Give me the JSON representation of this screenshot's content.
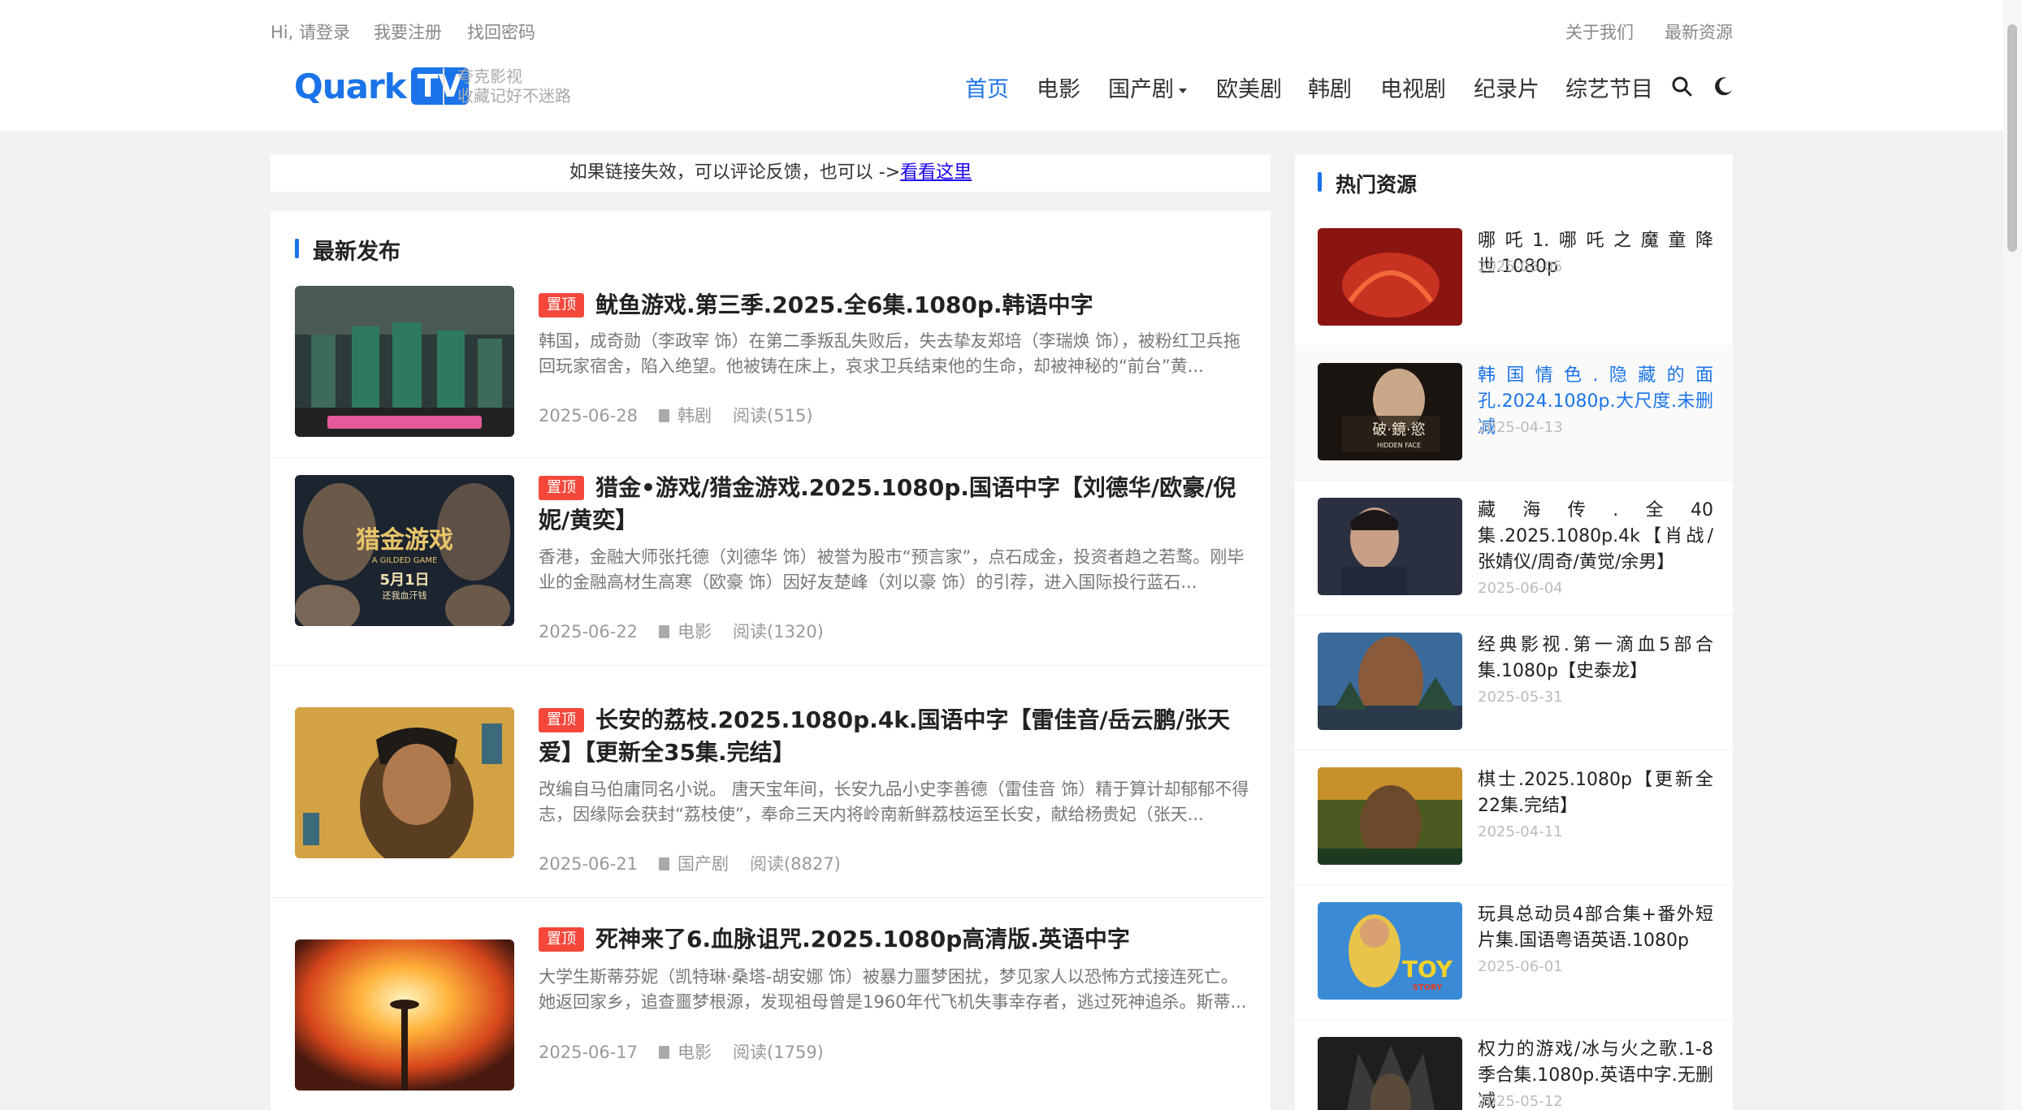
{
  "topbar": {
    "login": "Hi, 请登录",
    "register": "我要注册",
    "recover": "找回密码",
    "about": "关于我们",
    "latest": "最新资源"
  },
  "logo": {
    "quark": "Quark",
    "tv": "TV",
    "slogan_line1": "夸克影视",
    "slogan_line2": "收藏记好不迷路"
  },
  "nav": [
    "首页",
    "电影",
    "国产剧",
    "欧美剧",
    "韩剧",
    "电视剧",
    "纪录片",
    "综艺节目"
  ],
  "icons": {
    "search": "search-icon",
    "theme": "moon-icon"
  },
  "colors": {
    "accent": "#1a73e8",
    "badge": "#f5483b"
  },
  "notice": {
    "text": "如果链接失效，可以评论反馈，也可以 ->",
    "link": "看看这里"
  },
  "main": {
    "title": "最新发布",
    "badge": "置顶",
    "posts": [
      {
        "title": "鱿鱼游戏.第三季.2025.全6集.1080p.韩语中字",
        "excerpt": "韩国，成奇勋（李政宰 饰）在第二季叛乱失败后，失去挚友郑培（李瑞焕 饰），被粉红卫兵拖回玩家宿舍，陷入绝望。他被铸在床上，哀求卫兵结束他的生命，却被神秘的“前台”黄...",
        "date": "2025-06-28",
        "category": "韩剧",
        "views": "阅读(515)"
      },
      {
        "title": "猎金•游戏/猎金游戏.2025.1080p.国语中字【刘德华/欧豪/倪妮/黄奕】",
        "excerpt": "香港，金融大师张托德（刘德华 饰）被誉为股市“预言家”，点石成金，投资者趋之若鹜。刚毕业的金融高材生高寒（欧豪 饰）因好友楚峰（刘以豪 饰）的引荐，进入国际投行蓝石...",
        "date": "2025-06-22",
        "category": "电影",
        "views": "阅读(1320)"
      },
      {
        "title": "长安的荔枝.2025.1080p.4k.国语中字【雷佳音/岳云鹏/张天爱】【更新全35集.完结】",
        "excerpt": "改编自马伯庸同名小说。 唐天宝年间，长安九品小史李善德（雷佳音 饰）精于算计却郁郁不得志，因缘际会获封“荔枝使”，奉命三天内将岭南新鲜荔枝运至长安，献给杨贵妃（张天...",
        "date": "2025-06-21",
        "category": "国产剧",
        "views": "阅读(8827)"
      },
      {
        "title": "死神来了6.血脉诅咒.2025.1080p高清版.英语中字",
        "excerpt": "大学生斯蒂芬妮（凯特琳·桑塔-胡安娜 饰）被暴力噩梦困扰，梦见家人以恐怖方式接连死亡。她返回家乡，追查噩梦根源，发现祖母曾是1960年代飞机失事幸存者，逃过死神追杀。斯蒂...",
        "date": "2025-06-17",
        "category": "电影",
        "views": "阅读(1759)"
      }
    ]
  },
  "sidebar": {
    "title": "热门资源",
    "items": [
      {
        "title": "哪吒1.哪吒之魔童降世.1080p",
        "date": "2025-03-05"
      },
      {
        "title": "韩国情色.隐藏的面孔.2024.1080p.大尺度.未删减",
        "date": "2025-04-13"
      },
      {
        "title": "藏海传.全40集.2025.1080p.4k【肖战/张婧仪/周奇/黄觉/余男】",
        "date": "2025-06-04"
      },
      {
        "title": "经典影视.第一滴血5部合集.1080p【史泰龙】",
        "date": "2025-05-31"
      },
      {
        "title": "棋士.2025.1080p【更新全22集.完结】",
        "date": "2025-04-11"
      },
      {
        "title": "玩具总动员4部合集+番外短片集.国语粤语英语.1080p",
        "date": "2025-06-01"
      },
      {
        "title": "权力的游戏/冰与火之歌.1-8季合集.1080p.英语中字.无删减",
        "date": "2025-05-12"
      }
    ]
  },
  "thumb_texts": {
    "poster2_title": "猎金游戏",
    "poster2_sub": "A GILDED GAME",
    "poster2_date": "5月1日",
    "poster2_tag": "还我血汗钱",
    "side2_title": "破·鏡·慾",
    "side2_sub": "HIDDEN FACE",
    "side6_title": "TOY",
    "side6_sub": "STORY"
  }
}
